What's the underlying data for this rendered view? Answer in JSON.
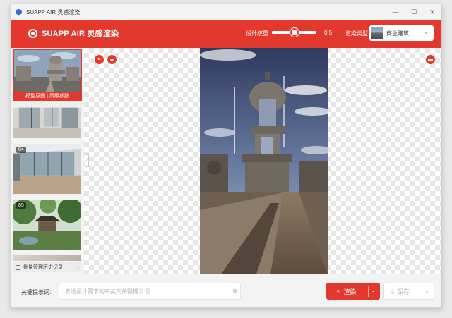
{
  "window": {
    "title": "SUAPP AIR 灵感渲染",
    "controls": {
      "minimize": "—",
      "maximize": "☐",
      "close": "✕"
    }
  },
  "header": {
    "brand": "SUAPP AIR 灵感渲染",
    "weight_label": "设计权重",
    "weight_value": "0.5",
    "weight_fraction": 0.5,
    "type_label": "渲染类型",
    "type_value": "商业建筑",
    "accent": "#e3382d"
  },
  "sidebar": {
    "active_label": "模型原图 | 高级参数",
    "items": [
      {
        "badge": "",
        "icon": "render-thumbnail"
      },
      {
        "badge": "",
        "icon": "interior-thumbnail"
      },
      {
        "badge": "84",
        "icon": "interior-thumbnail"
      },
      {
        "badge": "85",
        "icon": "garden-pavilion-thumbnail"
      }
    ],
    "history_label": "批量管理历史记录",
    "history_arrow": "›",
    "collapse": "‹"
  },
  "canvas": {
    "tools_left": [
      "crop-icon",
      "shield-icon"
    ],
    "tools_right": [
      "trash-icon"
    ]
  },
  "bottom": {
    "keyword_label": "关键提示词:",
    "keyword_placeholder": "表达设计需求的中英文关键提示词",
    "keyword_clear": "⊗",
    "render_label": "渲染",
    "render_icon": "✧",
    "save_label": "保存",
    "save_icon": "⤓",
    "dropdown": "⌄"
  }
}
